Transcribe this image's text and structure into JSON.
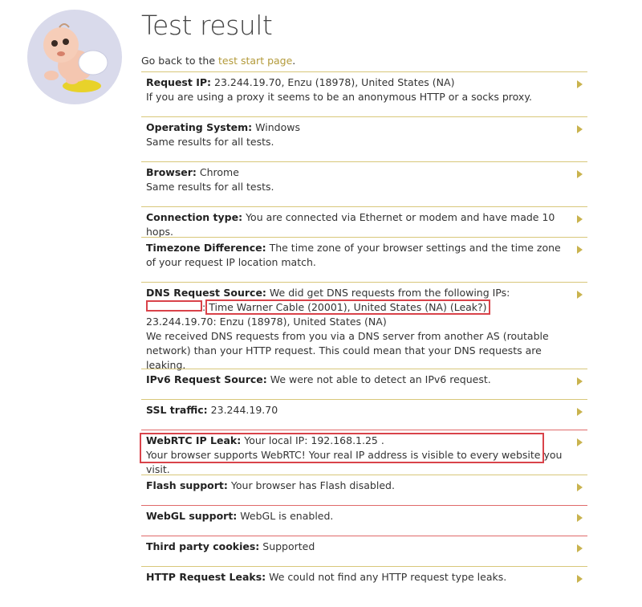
{
  "page": {
    "title": "Test result",
    "back_prefix": "Go back to the ",
    "back_link": "test start page",
    "back_suffix": "."
  },
  "colors": {
    "accent": "#b39a3a",
    "row_border": "#d8c77a",
    "arrow": "#c9b34e",
    "highlight": "#d9434a"
  },
  "results": [
    {
      "label": "Request IP:",
      "value": " 23.244.19.70, Enzu (18978), United States (NA)",
      "detail": "If you are using a proxy it seems to be an anonymous HTTP or a socks proxy."
    },
    {
      "label": "Operating System:",
      "value": " Windows",
      "detail": "Same results for all tests."
    },
    {
      "label": "Browser:",
      "value": " Chrome",
      "detail": "Same results for all tests."
    },
    {
      "label": "Connection type:",
      "value": " You are connected via Ethernet or modem and have made 10 hops."
    },
    {
      "label": "Timezone Difference:",
      "value": " The time zone of your browser settings and the time zone of your request IP location match."
    },
    {
      "label": "DNS Request Source:",
      "value": " We did get DNS requests from the following IPs:",
      "sep": ":",
      "leak_text": "Time Warner Cable (20001), United States (NA) (Leak?)",
      "line3": "23.244.19.70: Enzu (18978), United States (NA)",
      "detail": "We received DNS requests from you via a DNS server from another AS (routable network) than your HTTP request. This could mean that your DNS requests are leaking."
    },
    {
      "label": "IPv6 Request Source:",
      "value": " We were not able to detect an IPv6 request."
    },
    {
      "label": "SSL traffic:",
      "value": " 23.244.19.70"
    },
    {
      "label": "WebRTC IP Leak:",
      "value": " Your local IP: 192.168.1.25 .",
      "detail": "Your browser supports WebRTC! Your real IP address is visible to every website you visit."
    },
    {
      "label": "Flash support:",
      "value": " Your browser has Flash disabled."
    },
    {
      "label": "WebGL support:",
      "value": " WebGL is enabled."
    },
    {
      "label": "Third party cookies:",
      "value": " Supported"
    },
    {
      "label": "HTTP Request Leaks:",
      "value": " We could not find any HTTP request type leaks."
    }
  ]
}
